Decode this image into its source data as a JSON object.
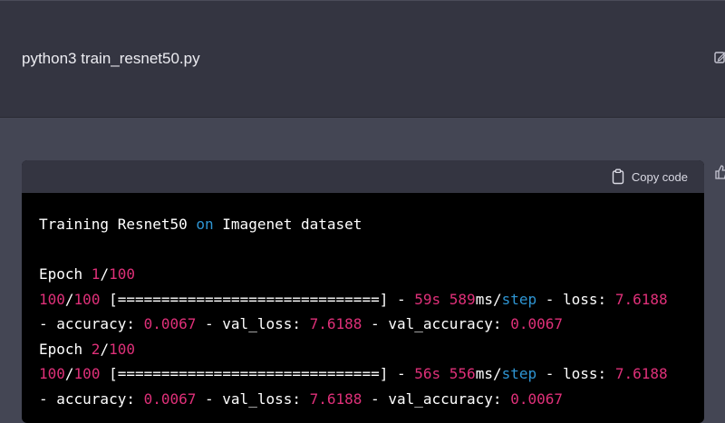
{
  "prompt": {
    "text": "python3 train_resnet50.py"
  },
  "code_block": {
    "copy_label": "Copy code",
    "lines": [
      [
        {
          "t": "Training Resnet50 "
        },
        {
          "t": "on",
          "c": "kw"
        },
        {
          "t": " Imagenet dataset"
        }
      ],
      [],
      [
        {
          "t": "Epoch "
        },
        {
          "t": "1",
          "c": "n"
        },
        {
          "t": "/"
        },
        {
          "t": "100",
          "c": "n"
        }
      ],
      [
        {
          "t": "100",
          "c": "n"
        },
        {
          "t": "/"
        },
        {
          "t": "100",
          "c": "n"
        },
        {
          "t": " [==============================] - "
        },
        {
          "t": "59s",
          "c": "n"
        },
        {
          "t": " "
        },
        {
          "t": "589",
          "c": "n"
        },
        {
          "t": "ms/"
        },
        {
          "t": "step",
          "c": "kw"
        },
        {
          "t": " - loss: "
        },
        {
          "t": "7.6188",
          "c": "n"
        }
      ],
      [
        {
          "t": "- accuracy: "
        },
        {
          "t": "0.0067",
          "c": "n"
        },
        {
          "t": " - val_loss: "
        },
        {
          "t": "7.6188",
          "c": "n"
        },
        {
          "t": " - val_accuracy: "
        },
        {
          "t": "0.0067",
          "c": "n"
        }
      ],
      [
        {
          "t": "Epoch "
        },
        {
          "t": "2",
          "c": "n"
        },
        {
          "t": "/"
        },
        {
          "t": "100",
          "c": "n"
        }
      ],
      [
        {
          "t": "100",
          "c": "n"
        },
        {
          "t": "/"
        },
        {
          "t": "100",
          "c": "n"
        },
        {
          "t": " [==============================] - "
        },
        {
          "t": "56s",
          "c": "n"
        },
        {
          "t": " "
        },
        {
          "t": "556",
          "c": "n"
        },
        {
          "t": "ms/"
        },
        {
          "t": "step",
          "c": "kw"
        },
        {
          "t": " - loss: "
        },
        {
          "t": "7.6188",
          "c": "n"
        }
      ],
      [
        {
          "t": "- accuracy: "
        },
        {
          "t": "0.0067",
          "c": "n"
        },
        {
          "t": " - val_loss: "
        },
        {
          "t": "7.6188",
          "c": "n"
        },
        {
          "t": " - val_accuracy: "
        },
        {
          "t": "0.0067",
          "c": "n"
        }
      ]
    ]
  },
  "icons": {
    "edit": "edit-icon",
    "copy": "clipboard-icon",
    "like": "thumbs-up-icon"
  },
  "colors": {
    "number": "#df3079",
    "keyword": "#2e95d3",
    "code_text": "#ffffff",
    "code_bg": "#000000",
    "header_bg": "#343541",
    "page_bg": "#444654"
  }
}
